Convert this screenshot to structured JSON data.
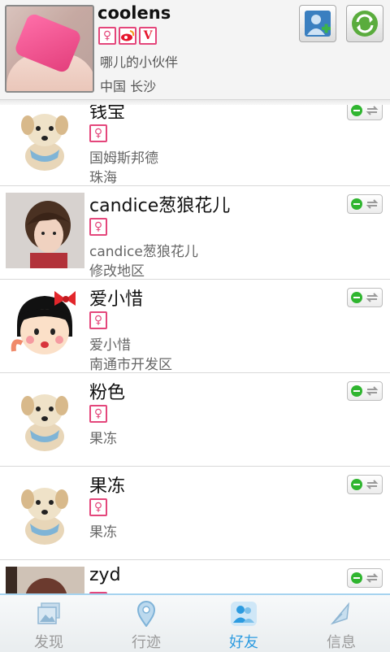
{
  "profile": {
    "name": "coolens",
    "badges": [
      "♀",
      "微博",
      "V"
    ],
    "signature": "哪儿的小伙伴",
    "location": "中国 长沙",
    "buttons": {
      "add_friend": "add-friend",
      "refresh": "refresh"
    }
  },
  "friends": [
    {
      "name": "钱宝",
      "gender": "♀",
      "line1": "国姆斯邦德",
      "line2": "珠海",
      "avatar": "dog",
      "status": "online"
    },
    {
      "name": "candice葱狼花儿",
      "gender": "♀",
      "line1": "candice葱狼花儿",
      "line2": "修改地区",
      "avatar": "boy",
      "status": "online"
    },
    {
      "name": "爱小惜",
      "gender": "♀",
      "line1": "爱小惜",
      "line2": "南通市开发区",
      "avatar": "girl-cartoon",
      "status": "online"
    },
    {
      "name": "粉色",
      "gender": "♀",
      "line1": "果冻",
      "line2": "",
      "avatar": "dog",
      "status": "online"
    },
    {
      "name": "果冻",
      "gender": "♀",
      "line1": "果冻",
      "line2": "",
      "avatar": "dog",
      "status": "online"
    },
    {
      "name": "zyd",
      "gender": "♀",
      "line1": "",
      "line2": "",
      "avatar": "photo",
      "status": "online"
    }
  ],
  "tabs": [
    {
      "label": "发现",
      "icon": "discover-icon",
      "active": false
    },
    {
      "label": "行迹",
      "icon": "location-pin-icon",
      "active": false
    },
    {
      "label": "好友",
      "icon": "friends-icon",
      "active": true
    },
    {
      "label": "信息",
      "icon": "messages-icon",
      "active": false
    }
  ],
  "colors": {
    "accent": "#2c9be0",
    "female": "#e4467b",
    "online": "#2fb52f"
  }
}
